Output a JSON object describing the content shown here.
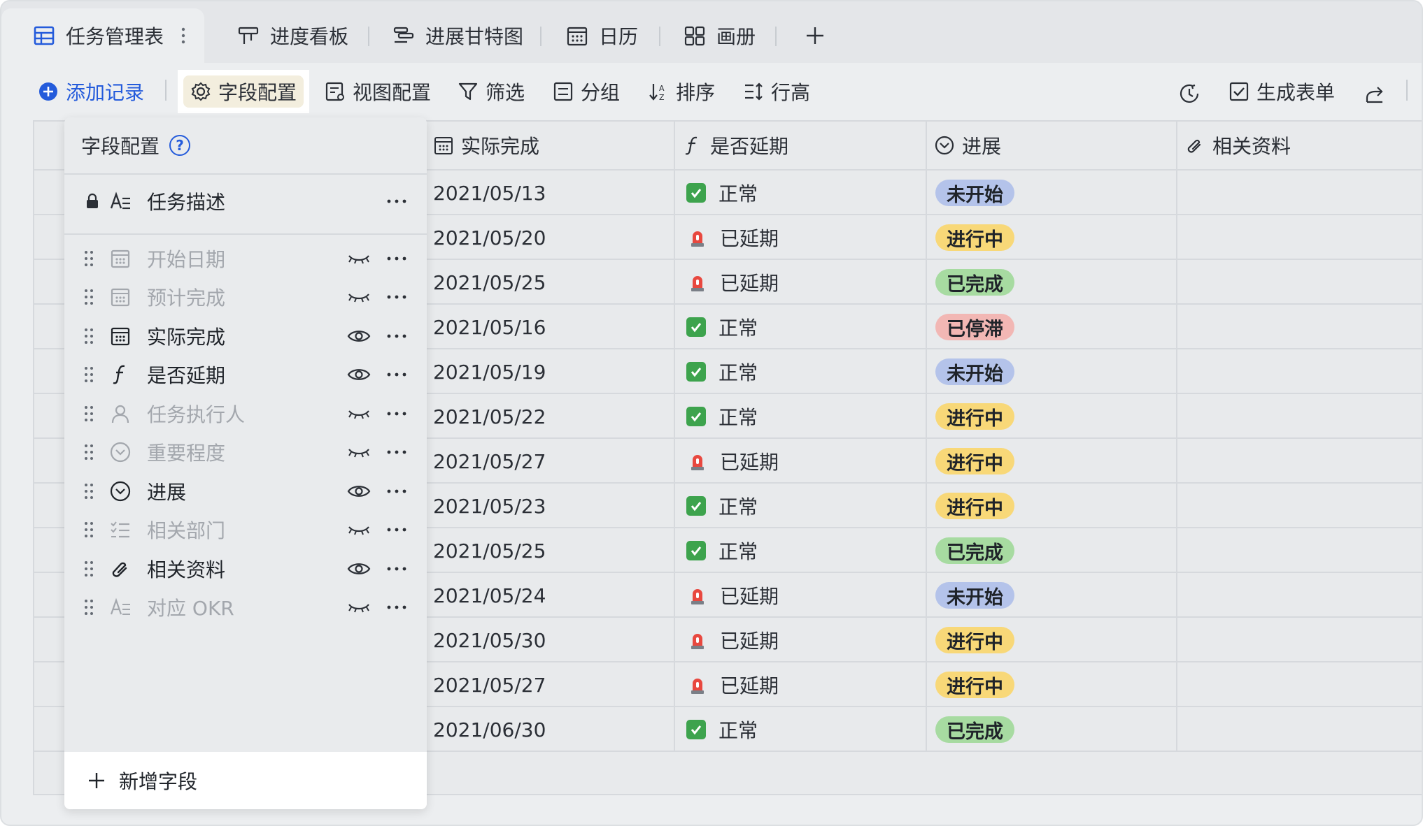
{
  "tabs": [
    {
      "label": "任务管理表",
      "icon": "table-icon",
      "active": true
    },
    {
      "label": "进度看板",
      "icon": "kanban-icon"
    },
    {
      "label": "进展甘特图",
      "icon": "gantt-icon"
    },
    {
      "label": "日历",
      "icon": "calendar-icon"
    },
    {
      "label": "画册",
      "icon": "gallery-icon"
    }
  ],
  "toolbar": {
    "add_record": "添加记录",
    "field_config": "字段配置",
    "view_config": "视图配置",
    "filter": "筛选",
    "group": "分组",
    "sort": "排序",
    "row_height": "行高",
    "generate_form": "生成表单"
  },
  "columns": {
    "actual_done": "实际完成",
    "delayed": "是否延期",
    "progress": "进展",
    "attachments": "相关资料"
  },
  "rows": [
    {
      "date": "2021/05/13",
      "status": "正常",
      "delayed": false,
      "progress": "未开始"
    },
    {
      "date": "2021/05/20",
      "status": "已延期",
      "delayed": true,
      "progress": "进行中"
    },
    {
      "date": "2021/05/25",
      "status": "已延期",
      "delayed": true,
      "progress": "已完成"
    },
    {
      "date": "2021/05/16",
      "status": "正常",
      "delayed": false,
      "progress": "已停滞"
    },
    {
      "date": "2021/05/19",
      "status": "正常",
      "delayed": false,
      "progress": "未开始"
    },
    {
      "date": "2021/05/22",
      "status": "正常",
      "delayed": false,
      "progress": "进行中"
    },
    {
      "date": "2021/05/27",
      "status": "已延期",
      "delayed": true,
      "progress": "进行中"
    },
    {
      "date": "2021/05/23",
      "status": "正常",
      "delayed": false,
      "progress": "进行中"
    },
    {
      "date": "2021/05/25",
      "status": "正常",
      "delayed": false,
      "progress": "已完成"
    },
    {
      "date": "2021/05/24",
      "status": "已延期",
      "delayed": true,
      "progress": "未开始"
    },
    {
      "date": "2021/05/30",
      "status": "已延期",
      "delayed": true,
      "progress": "进行中"
    },
    {
      "date": "2021/05/27",
      "status": "已延期",
      "delayed": true,
      "progress": "进行中"
    },
    {
      "date": "2021/06/30",
      "status": "正常",
      "delayed": false,
      "progress": "已完成"
    }
  ],
  "progress_colors": {
    "未开始": "#b4c3ea",
    "进行中": "#f8d878",
    "已完成": "#a7dba1",
    "已停滞": "#f2b7b4"
  },
  "popup": {
    "title": "字段配置",
    "help": "?",
    "primary_field": "任务描述",
    "fields": [
      {
        "label": "开始日期",
        "icon": "calendar-icon",
        "visible": false
      },
      {
        "label": "预计完成",
        "icon": "calendar-icon",
        "visible": false
      },
      {
        "label": "实际完成",
        "icon": "calendar-icon",
        "visible": true
      },
      {
        "label": "是否延期",
        "icon": "formula-icon",
        "visible": true
      },
      {
        "label": "任务执行人",
        "icon": "person-icon",
        "visible": false
      },
      {
        "label": "重要程度",
        "icon": "single-select-icon",
        "visible": false
      },
      {
        "label": "进展",
        "icon": "single-select-icon",
        "visible": true
      },
      {
        "label": "相关部门",
        "icon": "multi-select-icon",
        "visible": false
      },
      {
        "label": "相关资料",
        "icon": "attachment-icon",
        "visible": true
      },
      {
        "label": "对应 OKR",
        "icon": "text-icon",
        "visible": false
      }
    ],
    "add_field": "新增字段"
  }
}
